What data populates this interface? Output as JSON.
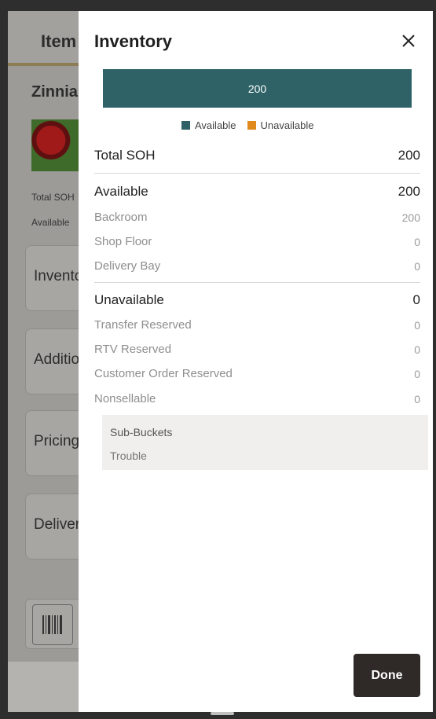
{
  "background": {
    "header_title": "Item",
    "product_name": "Zinnia",
    "total_soh_label": "Total SOH",
    "available_label": "Available",
    "cards": [
      {
        "label": "Inventory"
      },
      {
        "label": "Additional"
      },
      {
        "label": "Pricing"
      },
      {
        "label": "Delivery"
      }
    ],
    "scan_icon": "barcode-icon"
  },
  "drawer": {
    "title": "Inventory",
    "close_icon": "close-icon",
    "bar": {
      "value_label": "200",
      "available_fraction": 1.0,
      "color_available": "#2e6266",
      "color_unavailable": "#e08a1e"
    },
    "legend": [
      {
        "label": "Available",
        "color": "#2e6266"
      },
      {
        "label": "Unavailable",
        "color": "#e08a1e"
      }
    ],
    "total": {
      "label": "Total SOH",
      "value": "200"
    },
    "available": {
      "label": "Available",
      "value": "200",
      "items": [
        {
          "label": "Backroom",
          "value": "200"
        },
        {
          "label": "Shop Floor",
          "value": "0"
        },
        {
          "label": "Delivery Bay",
          "value": "0"
        }
      ]
    },
    "unavailable": {
      "label": "Unavailable",
      "value": "0",
      "items": [
        {
          "label": "Transfer Reserved",
          "value": "0"
        },
        {
          "label": "RTV Reserved",
          "value": "0"
        },
        {
          "label": "Customer Order Reserved",
          "value": "0"
        },
        {
          "label": "Nonsellable",
          "value": "0"
        }
      ]
    },
    "sub_buckets": {
      "title": "Sub-Buckets",
      "items": [
        "Trouble"
      ]
    },
    "done_label": "Done"
  }
}
